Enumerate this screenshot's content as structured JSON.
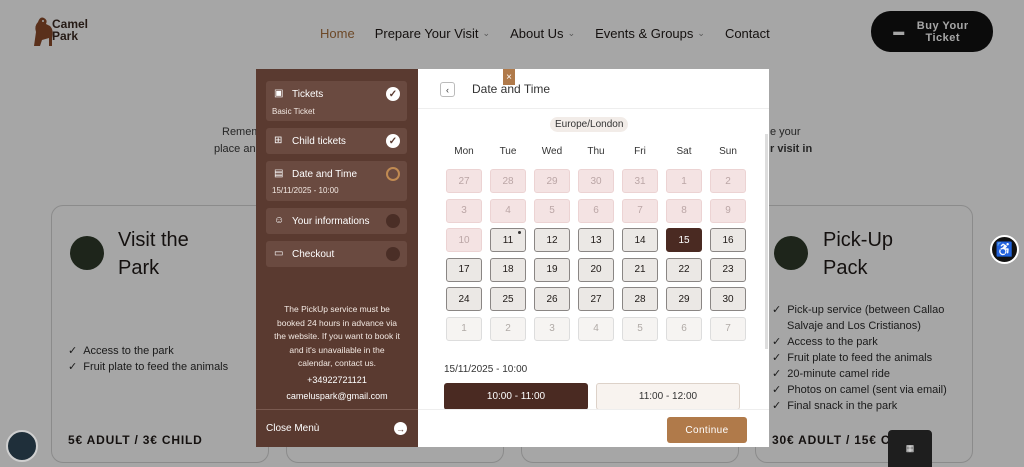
{
  "header": {
    "logo_text": "Camel Park",
    "nav": [
      {
        "label": "Home",
        "active": true,
        "dropdown": false
      },
      {
        "label": "Prepare Your Visit",
        "active": false,
        "dropdown": true
      },
      {
        "label": "About Us",
        "active": false,
        "dropdown": true
      },
      {
        "label": "Events & Groups",
        "active": false,
        "dropdown": true
      },
      {
        "label": "Contact",
        "active": false,
        "dropdown": false
      }
    ],
    "buy_label": "Buy Your Ticket"
  },
  "background": {
    "intro_left_1": "Remem",
    "intro_left_2": "place an",
    "intro_right_1": "e your",
    "intro_right_2": "r visit in",
    "card_left": {
      "title_1": "Visit the",
      "title_2": "Park",
      "items": [
        "Access to the park",
        "Fruit plate to feed the animals"
      ],
      "price": "5€ ADULT / 3€ CHILD"
    },
    "card_right": {
      "title_1": "Pick-Up",
      "title_2": "Pack",
      "items": [
        "Pick-up service (between Callao",
        "Salvaje and Los Cristianos)",
        "Access to the park",
        "Fruit plate to feed the animals",
        "20-minute camel ride",
        "Photos on camel (sent via email)",
        "Final snack in the park"
      ],
      "price": "30€ ADULT / 15€ C"
    }
  },
  "modal": {
    "steps": [
      {
        "label": "Tickets",
        "sub": "Basic Ticket",
        "state": "done"
      },
      {
        "label": "Child tickets",
        "sub": "",
        "state": "done"
      },
      {
        "label": "Date and Time",
        "sub": "15/11/2025 - 10:00",
        "state": "current"
      },
      {
        "label": "Your informations",
        "sub": "",
        "state": "todo"
      },
      {
        "label": "Checkout",
        "sub": "",
        "state": "todo"
      }
    ],
    "info_lines": [
      "The PickUp service must be",
      "booked 24 hours in advance via",
      "the website. If you want to book it",
      "and it's unavailable in the",
      "calendar, contact us."
    ],
    "phone": "+34922721121",
    "email": "cameluspark@gmail.com",
    "close_menu": "Close Menù",
    "title": "Date and Time",
    "timezone": "Europe/London",
    "weekdays": [
      "Mon",
      "Tue",
      "Wed",
      "Thu",
      "Fri",
      "Sat",
      "Sun"
    ],
    "days": [
      {
        "n": "27",
        "s": "past"
      },
      {
        "n": "28",
        "s": "past"
      },
      {
        "n": "29",
        "s": "past"
      },
      {
        "n": "30",
        "s": "past"
      },
      {
        "n": "31",
        "s": "past"
      },
      {
        "n": "1",
        "s": "past"
      },
      {
        "n": "2",
        "s": "past"
      },
      {
        "n": "3",
        "s": "past"
      },
      {
        "n": "4",
        "s": "past"
      },
      {
        "n": "5",
        "s": "past"
      },
      {
        "n": "6",
        "s": "past"
      },
      {
        "n": "7",
        "s": "past"
      },
      {
        "n": "8",
        "s": "past"
      },
      {
        "n": "9",
        "s": "past"
      },
      {
        "n": "10",
        "s": "past"
      },
      {
        "n": "11",
        "s": "avail",
        "dot": true
      },
      {
        "n": "12",
        "s": "avail"
      },
      {
        "n": "13",
        "s": "avail"
      },
      {
        "n": "14",
        "s": "avail"
      },
      {
        "n": "15",
        "s": "selected"
      },
      {
        "n": "16",
        "s": "avail"
      },
      {
        "n": "17",
        "s": "avail"
      },
      {
        "n": "18",
        "s": "avail"
      },
      {
        "n": "19",
        "s": "avail"
      },
      {
        "n": "20",
        "s": "avail"
      },
      {
        "n": "21",
        "s": "avail"
      },
      {
        "n": "22",
        "s": "avail"
      },
      {
        "n": "23",
        "s": "avail"
      },
      {
        "n": "24",
        "s": "avail"
      },
      {
        "n": "25",
        "s": "avail"
      },
      {
        "n": "26",
        "s": "avail"
      },
      {
        "n": "27",
        "s": "avail"
      },
      {
        "n": "28",
        "s": "avail"
      },
      {
        "n": "29",
        "s": "avail"
      },
      {
        "n": "30",
        "s": "avail"
      },
      {
        "n": "1",
        "s": "next"
      },
      {
        "n": "2",
        "s": "next"
      },
      {
        "n": "3",
        "s": "next"
      },
      {
        "n": "4",
        "s": "next"
      },
      {
        "n": "5",
        "s": "next"
      },
      {
        "n": "6",
        "s": "next"
      },
      {
        "n": "7",
        "s": "next"
      }
    ],
    "selected_datetime": "15/11/2025 - 10:00",
    "slots": [
      {
        "label": "10:00 - 11:00",
        "active": true
      },
      {
        "label": "11:00 - 12:00",
        "active": false
      }
    ],
    "continue_label": "Continue",
    "close_icon": "×"
  },
  "colors": {
    "brand_brown": "#5a3a30",
    "accent": "#b07a4a",
    "selected": "#4a2a22"
  }
}
